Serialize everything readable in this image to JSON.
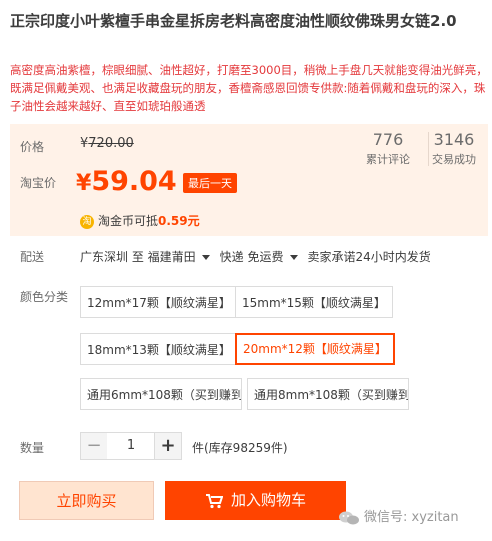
{
  "product": {
    "title": "正宗印度小叶紫檀手串金星拆房老料高密度油性顺纹佛珠男女链2.0",
    "subtitle": "高密度高油紫檀，棕眼细腻、油性超好，打磨至3000目，稍微上手盘几天就能变得油光鲜亮，既满足佩戴美观、也满足收藏盘玩的朋友，香檀斋感恩回馈专供款:随着佩戴和盘玩的深入，珠子油性会越来越好、直至如琥珀般通透"
  },
  "price": {
    "label": "价格",
    "currency": "¥",
    "original": "720.00",
    "taobao_label": "淘宝价",
    "current": "59.04",
    "badge": "最后一天",
    "reviews_count": "776",
    "reviews_label": "累计评论",
    "sales_count": "3146",
    "sales_label": "交易成功",
    "coin_icon": "淘",
    "coin_text": "淘金币可抵",
    "coin_value": "0.59元"
  },
  "shipping": {
    "label": "配送",
    "from": "广东深圳 至",
    "to": "福建莆田",
    "method": "快递 免运费",
    "promise": "卖家承诺24小时内发货"
  },
  "options": {
    "label": "颜色分类",
    "items": [
      "12mm*17颗【顺纹满星】",
      "15mm*15颗【顺纹满星】",
      "18mm*13颗【顺纹满星】",
      "20mm*12颗【顺纹满星】",
      "通用6mm*108颗（买到赚到",
      "通用8mm*108颗（买到赚到"
    ],
    "selected_index": 3
  },
  "quantity": {
    "label": "数量",
    "minus": "−",
    "value": "1",
    "plus": "+",
    "stock": "件(库存98259件)"
  },
  "actions": {
    "buy_now": "立即购买",
    "add_to_cart": "加入购物车"
  },
  "watermark": {
    "text": "微信号: xyzitan"
  },
  "colors": {
    "accent": "#ff4400",
    "price_bg": "#fff2e8"
  }
}
